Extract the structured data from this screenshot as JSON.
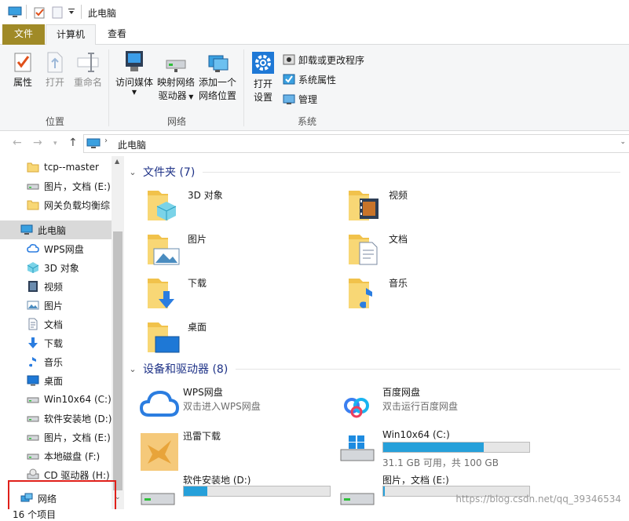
{
  "window": {
    "title": "此电脑"
  },
  "ribbon_tabs": {
    "file": "文件",
    "computer": "计算机",
    "view": "查看"
  },
  "ribbon": {
    "location": {
      "label": "位置",
      "properties": "属性",
      "open": "打开",
      "rename": "重命名"
    },
    "network": {
      "label": "网络",
      "media": "访问媒体",
      "map_drive_1": "映射网络",
      "map_drive_2": "驱动器",
      "add_location_1": "添加一个",
      "add_location_2": "网络位置"
    },
    "system": {
      "label": "系统",
      "open_settings_1": "打开",
      "open_settings_2": "设置",
      "uninstall": "卸载或更改程序",
      "sys_props": "系统属性",
      "manage": "管理"
    }
  },
  "address": {
    "path": "此电脑"
  },
  "nav_pane": {
    "quick": [
      {
        "label": "tcp--master",
        "icon": "folder-icon"
      },
      {
        "label": "图片，文档 (E:)",
        "icon": "drive-icon"
      },
      {
        "label": "网关负载均衡综",
        "icon": "folder-icon"
      }
    ],
    "this_pc": "此电脑",
    "items": [
      {
        "label": "WPS网盘",
        "icon": "cloud-icon"
      },
      {
        "label": "3D 对象",
        "icon": "3d-objects-icon"
      },
      {
        "label": "视频",
        "icon": "video-icon"
      },
      {
        "label": "图片",
        "icon": "pictures-icon"
      },
      {
        "label": "文档",
        "icon": "documents-icon"
      },
      {
        "label": "下载",
        "icon": "download-icon"
      },
      {
        "label": "音乐",
        "icon": "music-icon"
      },
      {
        "label": "桌面",
        "icon": "desktop-icon"
      },
      {
        "label": "Win10x64 (C:)",
        "icon": "drive-icon"
      },
      {
        "label": "软件安装地 (D:)",
        "icon": "drive-icon"
      },
      {
        "label": "图片，文档 (E:)",
        "icon": "drive-icon"
      },
      {
        "label": "本地磁盘 (F:)",
        "icon": "drive-icon"
      },
      {
        "label": "CD 驱动器 (H:)",
        "icon": "cd-drive-icon"
      }
    ],
    "network": "网络"
  },
  "content": {
    "folders_header": "文件夹 (7)",
    "folders": [
      {
        "name": "3D 对象",
        "icon": "3d-objects-icon"
      },
      {
        "name": "视频",
        "icon": "video-icon"
      },
      {
        "name": "图片",
        "icon": "pictures-icon"
      },
      {
        "name": "文档",
        "icon": "documents-icon"
      },
      {
        "name": "下载",
        "icon": "download-icon"
      },
      {
        "name": "音乐",
        "icon": "music-icon"
      },
      {
        "name": "桌面",
        "icon": "desktop-icon"
      }
    ],
    "drives_header": "设备和驱动器 (8)",
    "devices": [
      {
        "name": "WPS网盘",
        "sub": "双击进入WPS网盘",
        "icon": "wps-cloud-icon"
      },
      {
        "name": "百度网盘",
        "sub": "双击运行百度网盘",
        "icon": "baidu-netdisk-icon"
      },
      {
        "name": "迅雷下载",
        "sub": "",
        "icon": "xunlei-icon"
      },
      {
        "name": "Win10x64 (C:)",
        "sub": "31.1 GB 可用，共 100 GB",
        "used": 0.69,
        "icon": "windows-drive-icon"
      },
      {
        "name": "软件安装地 (D:)",
        "sub": "",
        "used": 0.16,
        "icon": "drive-icon"
      },
      {
        "name": "图片，文档 (E:)",
        "sub": "",
        "used": 0.01,
        "icon": "drive-icon"
      }
    ]
  },
  "status": {
    "count": "16 个项目"
  },
  "watermark": "https://blog.csdn.net/qq_39346534",
  "colors": {
    "file_tab": "#a08a27",
    "accent": "#1e3287",
    "drive_bar": "#26a0da",
    "highlight": "#e0201a"
  }
}
